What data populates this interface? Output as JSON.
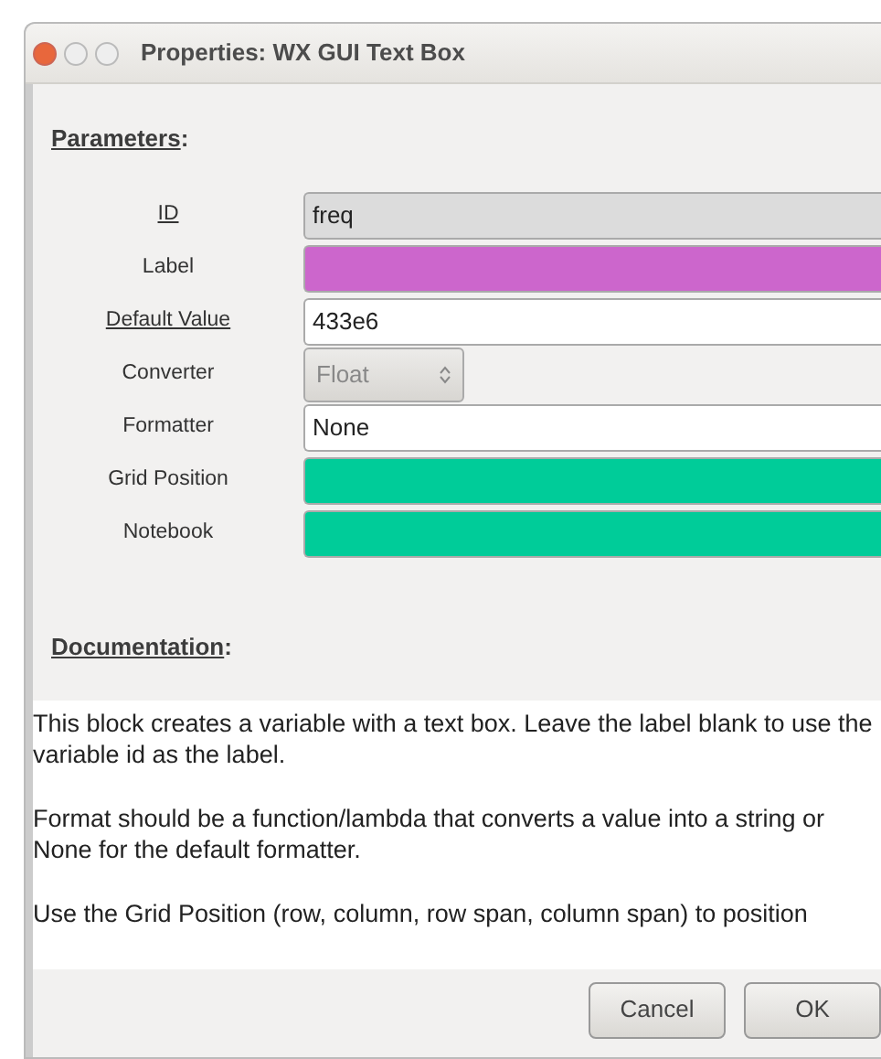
{
  "window": {
    "title": "Properties: WX GUI Text Box"
  },
  "parameters_heading": "Parameters",
  "heading_colon": ":",
  "parameters": [
    {
      "label": "ID",
      "underlined": true,
      "kind": "entry",
      "value": "freq",
      "color": "#dcdcdc"
    },
    {
      "label": "Label",
      "underlined": false,
      "kind": "entry",
      "color": "#cc66cc"
    },
    {
      "label": "Default Value",
      "underlined": true,
      "kind": "entry",
      "value": "433e6",
      "color": "#ffffff"
    },
    {
      "label": "Converter",
      "underlined": false,
      "kind": "combo",
      "value": "Float"
    },
    {
      "label": "Formatter",
      "underlined": false,
      "kind": "entry",
      "value": "None",
      "color": "#ffffff"
    },
    {
      "label": "Grid Position",
      "underlined": false,
      "kind": "entry",
      "color": "#00cc99"
    },
    {
      "label": "Notebook",
      "underlined": false,
      "kind": "entry",
      "color": "#00cc99"
    }
  ],
  "documentation_heading": "Documentation",
  "documentation": [
    "This block creates a variable with a text box. Leave the label blank to use the variable id as the label.",
    "Format should be a function/lambda that converts a value into a string or None for the default formatter.",
    "Use the Grid Position (row, column, row span, column span) to position"
  ],
  "buttons": [
    "Cancel",
    "OK"
  ]
}
